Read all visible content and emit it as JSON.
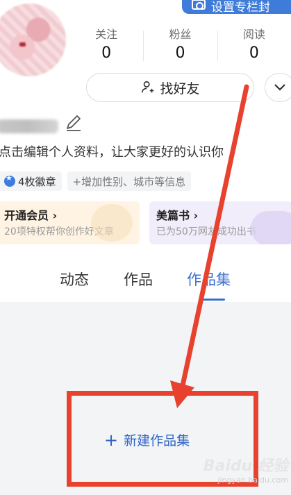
{
  "header": {
    "cover_button_label": "设置专栏封"
  },
  "stats": [
    {
      "label": "关注",
      "value": "0"
    },
    {
      "label": "粉丝",
      "value": "0"
    },
    {
      "label": "阅读",
      "value": "0"
    }
  ],
  "find_friends_label": "找好友",
  "profile": {
    "bio_prompt": "点击编辑个人资料，让大家更好的认识你",
    "badges_label": "4枚徽章",
    "add_info_label": "+增加性别、城市等信息"
  },
  "promo_cards": {
    "vip": {
      "title": "开通会员",
      "subtitle": "20项特权帮你创作好文章"
    },
    "book": {
      "title": "美篇书",
      "subtitle": "已为50万网友成功出书"
    }
  },
  "tabs": [
    {
      "label": "动态"
    },
    {
      "label": "作品"
    },
    {
      "label": "作品集"
    }
  ],
  "new_collection": {
    "label": "新建作品集"
  },
  "watermark": {
    "brand": "Baidu",
    "sub_label": "jingyan.baidu.com",
    "jingyan": "经验"
  },
  "colors": {
    "accent": "#3a6fcf",
    "annotation_red": "#e8412e",
    "cover_button": "#3f7bd9"
  }
}
